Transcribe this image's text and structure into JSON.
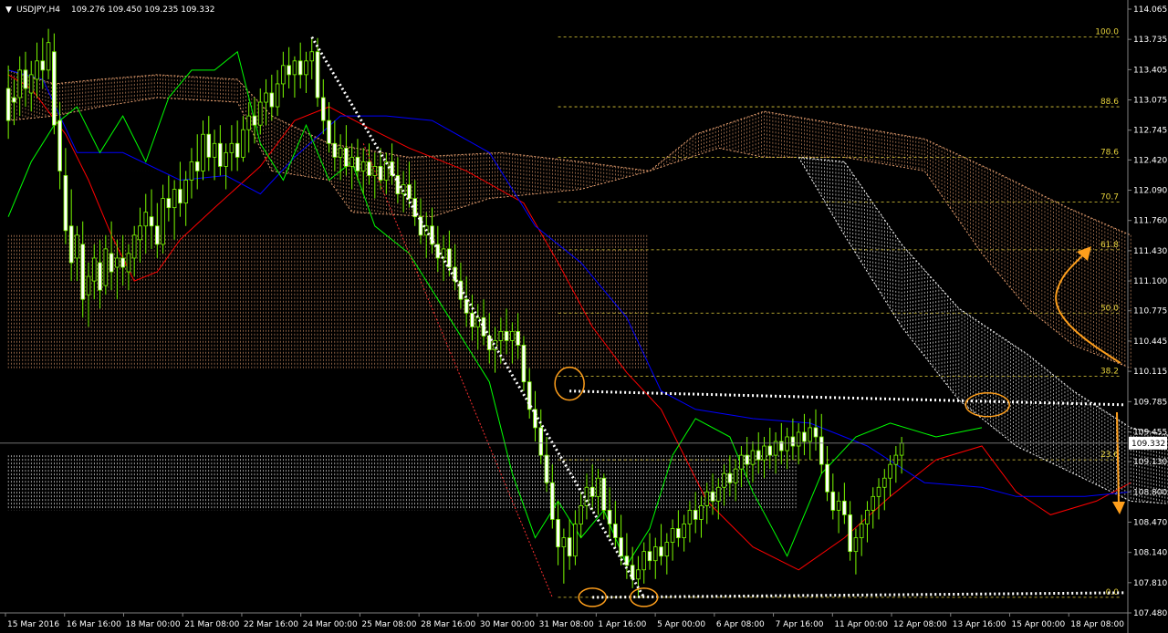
{
  "header": {
    "symbol_label": "USDJPY,H4",
    "ohlc_label": "109.276 109.450 109.235 109.332"
  },
  "colors": {
    "background": "#000000",
    "candle": "#7cfc00",
    "candle_body_bear": "#000000",
    "tenkan": "#ff0000",
    "kijun": "#0000ff",
    "chikou": "#00ff00",
    "cloud_a": "#e8a070",
    "cloud_b": "#ffffff",
    "fibo": "#e6d23c",
    "annotation": "#ff9f1c",
    "trendline": "#ffffff",
    "axis_text": "#ffffff",
    "price_line": "#808080"
  },
  "chart_data": {
    "type": "candlestick",
    "title": "USDJPY,H4",
    "ylim": [
      107.48,
      114.065
    ],
    "y_ticks": [
      "114.065",
      "113.735",
      "113.405",
      "113.075",
      "112.745",
      "112.420",
      "112.090",
      "111.760",
      "111.430",
      "111.100",
      "110.775",
      "110.445",
      "110.115",
      "109.785",
      "109.455",
      "109.130",
      "108.800",
      "108.470",
      "108.140",
      "107.810",
      "107.480"
    ],
    "x_ticks": [
      "15 Mar 2016",
      "16 Mar 16:00",
      "18 Mar 00:00",
      "21 Mar 08:00",
      "22 Mar 16:00",
      "24 Mar 00:00",
      "25 Mar 08:00",
      "28 Mar 16:00",
      "30 Mar 00:00",
      "31 Mar 08:00",
      "1 Apr 16:00",
      "5 Apr 00:00",
      "6 Apr 08:00",
      "7 Apr 16:00",
      "11 Apr 00:00",
      "12 Apr 08:00",
      "13 Apr 16:00",
      "15 Apr 00:00",
      "18 Apr 08:00"
    ],
    "current_price": 109.332,
    "current_price_label": "109.332",
    "fibonacci_levels": [
      {
        "label": "100.0",
        "price": 113.76
      },
      {
        "label": "88.6",
        "price": 113.0
      },
      {
        "label": "78.6",
        "price": 112.45
      },
      {
        "label": "70.7",
        "price": 111.96
      },
      {
        "label": "61.8",
        "price": 111.44
      },
      {
        "label": "50.0",
        "price": 110.75
      },
      {
        "label": "38.2",
        "price": 110.06
      },
      {
        "label": "23.6",
        "price": 109.15
      },
      {
        "label": "0.0",
        "price": 107.65
      }
    ],
    "candle_count": 196,
    "candles": [
      [
        113.2,
        113.45,
        112.65,
        112.85
      ],
      [
        113.1,
        113.3,
        112.8,
        113.05
      ],
      [
        113.1,
        113.55,
        112.9,
        113.4
      ],
      [
        113.4,
        113.6,
        113.0,
        113.2
      ],
      [
        113.15,
        113.5,
        112.95,
        113.35
      ],
      [
        113.3,
        113.7,
        113.1,
        113.5
      ],
      [
        113.5,
        113.75,
        113.2,
        113.4
      ],
      [
        113.4,
        113.85,
        113.3,
        113.7
      ],
      [
        113.6,
        113.8,
        112.7,
        112.8
      ],
      [
        112.85,
        113.05,
        112.1,
        112.3
      ],
      [
        112.25,
        112.55,
        111.5,
        111.65
      ],
      [
        111.7,
        112.1,
        111.1,
        111.3
      ],
      [
        111.35,
        111.7,
        111.1,
        111.6
      ],
      [
        111.5,
        111.75,
        110.7,
        110.9
      ],
      [
        110.95,
        111.3,
        110.6,
        111.15
      ],
      [
        111.1,
        111.5,
        110.9,
        111.35
      ],
      [
        111.3,
        111.55,
        110.8,
        111.0
      ],
      [
        111.05,
        111.6,
        110.95,
        111.45
      ],
      [
        111.4,
        111.75,
        111.0,
        111.2
      ],
      [
        111.25,
        111.55,
        110.9,
        111.35
      ],
      [
        111.35,
        111.6,
        111.05,
        111.25
      ],
      [
        111.2,
        111.5,
        111.0,
        111.4
      ],
      [
        111.35,
        111.7,
        111.15,
        111.6
      ],
      [
        111.55,
        111.9,
        111.3,
        111.7
      ],
      [
        111.7,
        112.05,
        111.4,
        111.85
      ],
      [
        111.8,
        112.1,
        111.45,
        111.7
      ],
      [
        111.7,
        111.95,
        111.35,
        111.5
      ],
      [
        111.5,
        112.15,
        111.4,
        112.0
      ],
      [
        112.0,
        112.25,
        111.75,
        111.9
      ],
      [
        111.9,
        112.2,
        111.55,
        112.1
      ],
      [
        112.1,
        112.4,
        111.8,
        111.95
      ],
      [
        111.95,
        112.3,
        111.7,
        112.2
      ],
      [
        112.2,
        112.55,
        112.0,
        112.4
      ],
      [
        112.4,
        112.7,
        112.1,
        112.3
      ],
      [
        112.3,
        112.85,
        112.2,
        112.7
      ],
      [
        112.7,
        112.9,
        112.3,
        112.45
      ],
      [
        112.45,
        112.75,
        112.2,
        112.6
      ],
      [
        112.6,
        112.8,
        112.25,
        112.35
      ],
      [
        112.35,
        112.6,
        112.1,
        112.5
      ],
      [
        112.5,
        112.8,
        112.3,
        112.6
      ],
      [
        112.6,
        112.85,
        112.3,
        112.45
      ],
      [
        112.45,
        112.9,
        112.4,
        112.75
      ],
      [
        112.75,
        113.05,
        112.5,
        112.9
      ],
      [
        112.9,
        113.1,
        112.6,
        112.8
      ],
      [
        112.8,
        113.2,
        112.7,
        113.05
      ],
      [
        113.05,
        113.3,
        112.8,
        113.15
      ],
      [
        113.15,
        113.35,
        112.85,
        113.0
      ],
      [
        113.0,
        113.4,
        112.9,
        113.25
      ],
      [
        113.25,
        113.6,
        113.1,
        113.45
      ],
      [
        113.45,
        113.65,
        113.2,
        113.35
      ],
      [
        113.35,
        113.55,
        113.1,
        113.5
      ],
      [
        113.5,
        113.7,
        113.2,
        113.35
      ],
      [
        113.35,
        113.6,
        113.15,
        113.5
      ],
      [
        113.5,
        113.76,
        113.3,
        113.6
      ],
      [
        113.6,
        113.75,
        113.0,
        113.1
      ],
      [
        113.1,
        113.3,
        112.7,
        112.85
      ],
      [
        112.85,
        113.05,
        112.5,
        112.6
      ],
      [
        112.6,
        112.85,
        112.3,
        112.45
      ],
      [
        112.45,
        112.7,
        112.2,
        112.55
      ],
      [
        112.55,
        112.8,
        112.25,
        112.35
      ],
      [
        112.35,
        112.6,
        112.1,
        112.45
      ],
      [
        112.45,
        112.65,
        112.2,
        112.3
      ],
      [
        112.3,
        112.55,
        112.05,
        112.4
      ],
      [
        112.4,
        112.6,
        112.15,
        112.25
      ],
      [
        112.25,
        112.5,
        112.0,
        112.35
      ],
      [
        112.35,
        112.55,
        112.1,
        112.2
      ],
      [
        112.2,
        112.5,
        112.05,
        112.4
      ],
      [
        112.4,
        112.6,
        112.15,
        112.25
      ],
      [
        112.25,
        112.45,
        111.95,
        112.05
      ],
      [
        112.05,
        112.3,
        111.85,
        112.15
      ],
      [
        112.15,
        112.4,
        111.9,
        112.0
      ],
      [
        112.0,
        112.2,
        111.7,
        111.8
      ],
      [
        111.8,
        112.0,
        111.5,
        111.6
      ],
      [
        111.6,
        111.85,
        111.35,
        111.7
      ],
      [
        111.7,
        111.9,
        111.4,
        111.5
      ],
      [
        111.5,
        111.7,
        111.2,
        111.35
      ],
      [
        111.35,
        111.6,
        111.1,
        111.45
      ],
      [
        111.45,
        111.65,
        111.15,
        111.25
      ],
      [
        111.25,
        111.5,
        111.0,
        111.1
      ],
      [
        111.1,
        111.3,
        110.8,
        110.9
      ],
      [
        110.9,
        111.15,
        110.6,
        110.75
      ],
      [
        110.75,
        110.95,
        110.45,
        110.6
      ],
      [
        110.6,
        110.85,
        110.35,
        110.7
      ],
      [
        110.7,
        110.9,
        110.4,
        110.5
      ],
      [
        110.5,
        110.75,
        110.2,
        110.35
      ],
      [
        110.35,
        110.6,
        110.1,
        110.45
      ],
      [
        110.45,
        110.7,
        110.2,
        110.55
      ],
      [
        110.55,
        110.8,
        110.3,
        110.45
      ],
      [
        110.45,
        110.65,
        110.2,
        110.55
      ],
      [
        110.55,
        110.75,
        110.25,
        110.4
      ],
      [
        110.4,
        110.5,
        109.9,
        110.0
      ],
      [
        110.0,
        110.15,
        109.6,
        109.7
      ],
      [
        109.7,
        109.9,
        109.35,
        109.5
      ],
      [
        109.5,
        109.7,
        109.1,
        109.2
      ],
      [
        109.2,
        109.4,
        108.8,
        108.9
      ],
      [
        108.9,
        109.1,
        108.4,
        108.5
      ],
      [
        108.5,
        108.7,
        108.0,
        108.2
      ],
      [
        108.2,
        108.4,
        107.8,
        108.3
      ],
      [
        108.3,
        108.5,
        107.95,
        108.1
      ],
      [
        108.1,
        108.6,
        108.0,
        108.45
      ],
      [
        108.45,
        108.8,
        108.3,
        108.65
      ],
      [
        108.65,
        109.0,
        108.5,
        108.85
      ],
      [
        108.85,
        109.1,
        108.6,
        108.75
      ],
      [
        108.75,
        109.05,
        108.55,
        108.95
      ],
      [
        108.95,
        109.0,
        108.5,
        108.6
      ],
      [
        108.6,
        108.85,
        108.3,
        108.45
      ],
      [
        108.45,
        108.7,
        108.2,
        108.3
      ],
      [
        108.3,
        108.55,
        108.0,
        108.1
      ],
      [
        108.1,
        108.35,
        107.85,
        108.0
      ],
      [
        108.0,
        108.2,
        107.75,
        107.85
      ],
      [
        107.85,
        108.1,
        107.65,
        107.95
      ],
      [
        107.95,
        108.25,
        107.8,
        108.15
      ],
      [
        108.15,
        108.35,
        107.95,
        108.05
      ],
      [
        108.05,
        108.3,
        107.85,
        108.2
      ],
      [
        108.2,
        108.45,
        108.0,
        108.1
      ],
      [
        108.1,
        108.35,
        107.9,
        108.25
      ],
      [
        108.25,
        108.5,
        108.05,
        108.4
      ],
      [
        108.4,
        108.6,
        108.2,
        108.3
      ],
      [
        108.3,
        108.55,
        108.15,
        108.45
      ],
      [
        108.45,
        108.7,
        108.25,
        108.6
      ],
      [
        108.6,
        108.8,
        108.35,
        108.5
      ],
      [
        108.5,
        108.75,
        108.3,
        108.65
      ],
      [
        108.65,
        108.9,
        108.45,
        108.8
      ],
      [
        108.8,
        109.0,
        108.55,
        108.7
      ],
      [
        108.7,
        108.95,
        108.5,
        108.85
      ],
      [
        108.85,
        109.1,
        108.65,
        109.0
      ],
      [
        109.0,
        109.2,
        108.75,
        108.9
      ],
      [
        108.9,
        109.15,
        108.7,
        109.05
      ],
      [
        109.05,
        109.3,
        108.85,
        109.2
      ],
      [
        109.2,
        109.4,
        108.95,
        109.1
      ],
      [
        109.1,
        109.35,
        108.9,
        109.25
      ],
      [
        109.25,
        109.45,
        109.0,
        109.15
      ],
      [
        109.15,
        109.4,
        108.95,
        109.3
      ],
      [
        109.3,
        109.5,
        109.05,
        109.2
      ],
      [
        109.2,
        109.45,
        109.0,
        109.35
      ],
      [
        109.35,
        109.55,
        109.1,
        109.25
      ],
      [
        109.25,
        109.5,
        109.05,
        109.4
      ],
      [
        109.4,
        109.6,
        109.15,
        109.3
      ],
      [
        109.3,
        109.55,
        109.1,
        109.45
      ],
      [
        109.45,
        109.65,
        109.2,
        109.35
      ],
      [
        109.35,
        109.6,
        109.15,
        109.5
      ],
      [
        109.5,
        109.7,
        109.25,
        109.4
      ],
      [
        109.4,
        109.65,
        109.0,
        109.1
      ],
      [
        109.1,
        109.3,
        108.7,
        108.8
      ],
      [
        108.8,
        109.0,
        108.5,
        108.6
      ],
      [
        108.6,
        108.8,
        108.35,
        108.7
      ],
      [
        108.7,
        108.9,
        108.45,
        108.55
      ],
      [
        108.55,
        108.7,
        108.05,
        108.15
      ],
      [
        108.15,
        108.4,
        107.9,
        108.3
      ],
      [
        108.3,
        108.55,
        108.1,
        108.45
      ],
      [
        108.45,
        108.7,
        108.25,
        108.6
      ],
      [
        108.6,
        108.85,
        108.4,
        108.75
      ],
      [
        108.75,
        108.95,
        108.5,
        108.85
      ],
      [
        108.85,
        109.05,
        108.6,
        108.95
      ],
      [
        108.95,
        109.2,
        108.75,
        109.1
      ],
      [
        109.1,
        109.3,
        108.9,
        109.2
      ],
      [
        109.2,
        109.4,
        109.0,
        109.332
      ]
    ]
  }
}
